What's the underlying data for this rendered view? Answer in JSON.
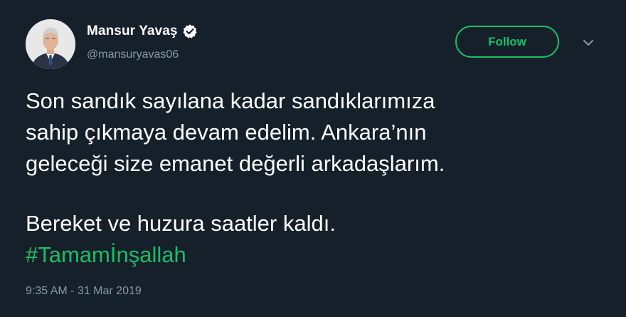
{
  "author": {
    "display_name": "Mansur Yavaş",
    "handle": "@mansuryavas06",
    "verified": true,
    "avatar_icon": "user-avatar-photo"
  },
  "actions": {
    "follow_label": "Follow",
    "menu_icon": "chevron-down-icon"
  },
  "tweet": {
    "line1": "Son sandık sayılana kadar sandıklarımıza",
    "line2": "sahip çıkmaya devam edelim. Ankara’nın",
    "line3": "geleceği size emanet değerli arkadaşlarım.",
    "line4": "Bereket ve huzura saatler kaldı.",
    "hashtag": "#Tamamİnşallah",
    "timestamp": "9:35 AM - 31 Mar 2019"
  },
  "colors": {
    "background": "#15202b",
    "accent": "#17bf63",
    "secondary_text": "#8899a6",
    "primary_text": "#ffffff"
  }
}
